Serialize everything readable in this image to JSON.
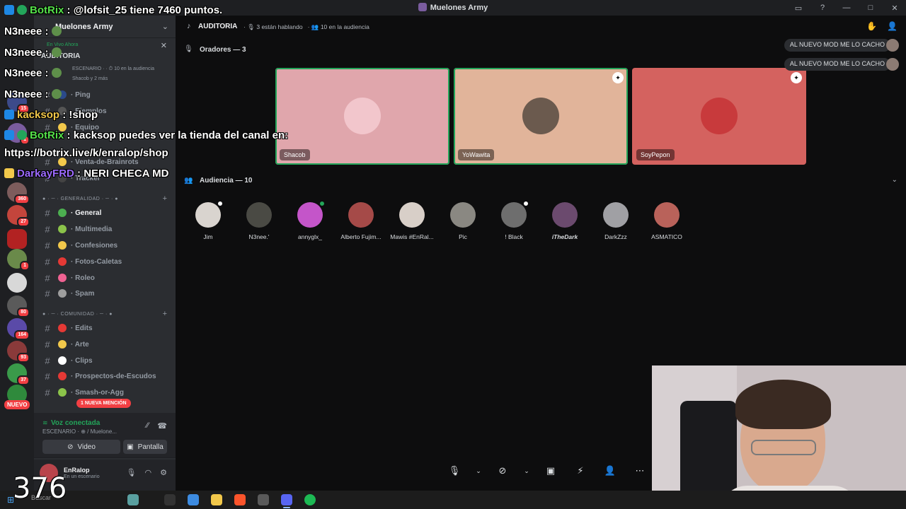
{
  "window": {
    "title": "Muelones Army",
    "buttons": [
      "▭",
      "?",
      "—",
      "□",
      "✕"
    ]
  },
  "rail": {
    "badges": [
      "15",
      "1",
      "360",
      "27",
      "1",
      "80",
      "164",
      "93",
      "37"
    ],
    "new_label": "NUEVO"
  },
  "sidebar": {
    "guild_name": "Muelones Army",
    "stage_card": {
      "live": "En Vivo Ahora",
      "title": "AUDITORIA",
      "meta": "ESCENARIO · · ⏱ 10 en la audiencia",
      "speakers": "Shacob y 2 más"
    },
    "channels_top": [
      {
        "label": "· Ping"
      },
      {
        "label": "· Ejemplos"
      },
      {
        "label": "· Equipo"
      },
      {
        "label": "· Venta-de-Brainrots"
      },
      {
        "label": "· Tracker"
      }
    ],
    "category_general": "GENERALIDAD",
    "channels_general": [
      {
        "label": "· General",
        "color": "#4caf50"
      },
      {
        "label": "· Multimedia",
        "color": "#8bc34a"
      },
      {
        "label": "· Confesiones",
        "color": "#f2c84b"
      },
      {
        "label": "· Fotos-Caletas",
        "color": "#e53935"
      },
      {
        "label": "· Roleo",
        "color": "#f06292"
      },
      {
        "label": "· Spam",
        "color": "#9e9e9e"
      }
    ],
    "category_comunidad": "COMUNIDAD",
    "channels_comunidad": [
      {
        "label": "· Edits",
        "color": "#e53935"
      },
      {
        "label": "· Arte",
        "color": "#f2c84b"
      },
      {
        "label": "· Clips",
        "color": "#ffffff"
      },
      {
        "label": "· Prospectos-de-Escudos",
        "color": "#e53935"
      },
      {
        "label": "· Smash-or-Agg",
        "color": "#8bc34a"
      }
    ],
    "mention_pill": "1 NUEVA MENCIÓN",
    "voice": {
      "status": "Voz conectada",
      "where": "ESCENARIO · ⊕ / Muelone...",
      "video_label": "Video",
      "screen_label": "Pantalla"
    },
    "user": {
      "name": "EnRalop",
      "status": "En un escenario"
    }
  },
  "stage": {
    "title": "AUDITORIA",
    "meta_speaking": "3 están hablando",
    "meta_audience": "10 en la audiencia",
    "speakers_title": "Oradores — 3",
    "audience_title": "Audiencia — 10",
    "speakers": [
      {
        "name": "Shacob",
        "bg": "#e0a6ac",
        "face": "#f2c6cc",
        "speaking": true,
        "mod": false
      },
      {
        "name": "YoWawita",
        "bg": "#e1b49a",
        "face": "#6b5a4e",
        "speaking": true,
        "mod": true
      },
      {
        "name": "SoyPepon",
        "bg": "#d4625f",
        "face": "#c83a3c",
        "speaking": false,
        "mod": true
      }
    ],
    "audience": [
      {
        "name": "Jim",
        "color": "#d9d4cf",
        "dot": "white"
      },
      {
        "name": "N3nee.'",
        "color": "#4a4a44",
        "dot": ""
      },
      {
        "name": "annyglx_",
        "color": "#c455c9",
        "dot": "green"
      },
      {
        "name": "Alberto Fujim...",
        "color": "#a54a48",
        "dot": ""
      },
      {
        "name": "Mawis #EnRal...",
        "color": "#d8cfc8",
        "dot": ""
      },
      {
        "name": "Pic",
        "color": "#8a8882",
        "dot": ""
      },
      {
        "name": "! Black",
        "color": "#6e6e6e",
        "dot": "white"
      },
      {
        "name": "iTheDark",
        "color": "#6b4a6e",
        "dot": ""
      },
      {
        "name": "DarkZzz",
        "color": "#a0a0a4",
        "dot": ""
      },
      {
        "name": "ASMATICO",
        "color": "#b9625a",
        "dot": ""
      }
    ],
    "notices": [
      "AL NUEVO MOD ME LO CACHO",
      "AL NUEVO MOD ME LO CACHO"
    ]
  },
  "taskbar": {
    "search": "Buscar"
  },
  "chat_overlay": [
    {
      "user": "BotRix",
      "sep": " : ",
      "text": "@lofsit_25 tiene 7460 puntos.",
      "cls": "u-bot"
    },
    {
      "user": "N3neee",
      "sep": " : ",
      "text": "",
      "cls": "u-n3"
    },
    {
      "user": "N3neee",
      "sep": " : ",
      "text": "",
      "cls": "u-n3"
    },
    {
      "user": "N3neee",
      "sep": " : ",
      "text": "",
      "cls": "u-n3"
    },
    {
      "user": "N3neee",
      "sep": " : ",
      "text": "",
      "cls": "u-n3"
    },
    {
      "user": "kacksop",
      "sep": " : ",
      "text": "!shop",
      "cls": "u-kack"
    },
    {
      "user": "BotRix",
      "sep": " : ",
      "text": "kacksop puedes ver la tienda del canal en:",
      "cls": "u-bot"
    },
    {
      "user": "",
      "sep": "",
      "text": "https://botrix.live/k/enralop/shop",
      "cls": ""
    },
    {
      "user": "DarkayFRD",
      "sep": " : ",
      "text": "NERI CHECA MD",
      "cls": "u-dark"
    }
  ],
  "counter": "376",
  "colors": {
    "accent_green": "#23a55a",
    "danger": "#da373c",
    "sidebar": "#2b2d31",
    "rail": "#1e1f22"
  }
}
